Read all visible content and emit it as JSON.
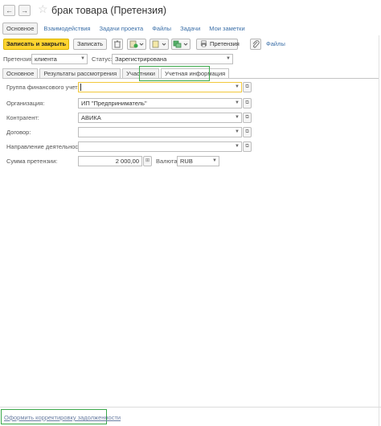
{
  "window": {
    "title": "брак товара (Претензия)",
    "back_icon": "←",
    "forward_icon": "→",
    "star_icon": "☆"
  },
  "top_nav": {
    "tabs": [
      "Основное",
      "Взаимодействия",
      "Задачи проекта",
      "Файлы",
      "Задачи",
      "Мои заметки"
    ]
  },
  "toolbar": {
    "save_close_label": "Записать и закрыть",
    "save_label": "Записать",
    "claim_print_label": "Претензия",
    "files_label": "Файлы",
    "accent_color": "#ffd42f"
  },
  "header_fields": {
    "claim_label": "Претензия:",
    "claim_value": "клиента",
    "status_label": "Статус:",
    "status_value": "Зарегистрирована"
  },
  "form_tabs": [
    "Основное",
    "Результаты рассмотрения",
    "Участники",
    "Учетная информация"
  ],
  "fields": {
    "fin_group_label": "Группа финансового учета:",
    "fin_group_value": "",
    "org_label": "Организация:",
    "org_value": "ИП \"Предприниматель\"",
    "contractor_label": "Контрагент:",
    "contractor_value": "АВИКА",
    "contract_label": "Договор:",
    "contract_value": "",
    "direction_label": "Направление деятельности:",
    "direction_value": "",
    "amount_label": "Сумма претензии:",
    "amount_value": "2 000,00",
    "currency_label": "Валюта:",
    "currency_value": "RUB"
  },
  "footer": {
    "adjust_debt_link": "Оформить корректировку задолженности"
  },
  "highlight_color": "#3aa84a"
}
